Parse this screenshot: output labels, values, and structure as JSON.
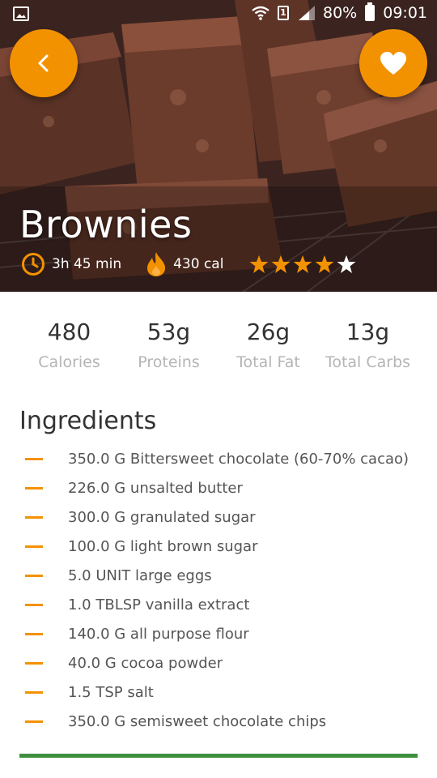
{
  "status_bar": {
    "battery": "80%",
    "time": "09:01",
    "sim": "1"
  },
  "header": {
    "title": "Brownies",
    "time": "3h 45 min",
    "calories": "430 cal",
    "rating": 4,
    "rating_max": 5
  },
  "nutrition": [
    {
      "value": "480",
      "label": "Calories"
    },
    {
      "value": "53g",
      "label": "Proteins"
    },
    {
      "value": "26g",
      "label": "Total Fat"
    },
    {
      "value": "13g",
      "label": "Total Carbs"
    }
  ],
  "ingredients": {
    "title": "Ingredients",
    "items": [
      "350.0 G Bittersweet chocolate (60-70% cacao)",
      "226.0 G unsalted butter",
      "300.0 G granulated sugar",
      "100.0 G light brown sugar",
      "5.0 UNIT large eggs",
      "1.0 TBLSP vanilla extract",
      "140.0 G all purpose flour",
      "40.0 G cocoa powder",
      "1.5 TSP salt",
      "350.0 G semisweet chocolate chips"
    ]
  },
  "colors": {
    "accent": "#f39200",
    "divider": "#3f8f3f",
    "star_filled": "#f39200",
    "star_empty": "#ffffff"
  },
  "icons": {
    "back": "chevron-left-icon",
    "favorite": "heart-icon",
    "time": "clock-icon",
    "calories": "flame-icon"
  }
}
